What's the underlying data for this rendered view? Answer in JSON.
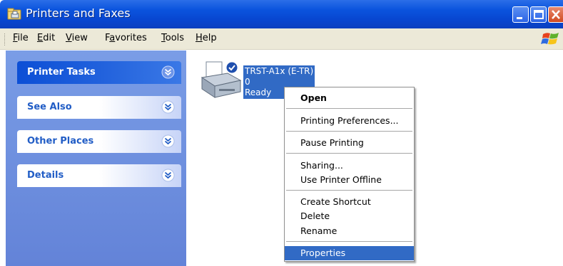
{
  "window": {
    "title": "Printers and Faxes",
    "icon": "printers-folder-icon"
  },
  "menubar": {
    "items": [
      {
        "label": "File",
        "accesskey": "F"
      },
      {
        "label": "Edit",
        "accesskey": "E"
      },
      {
        "label": "View",
        "accesskey": "V"
      },
      {
        "label": "Favorites",
        "accesskey": "a"
      },
      {
        "label": "Tools",
        "accesskey": "T"
      },
      {
        "label": "Help",
        "accesskey": "H"
      }
    ]
  },
  "taskpane": {
    "panels": [
      {
        "label": "Printer Tasks",
        "active": true
      },
      {
        "label": "See Also",
        "active": false
      },
      {
        "label": "Other Places",
        "active": false
      },
      {
        "label": "Details",
        "active": false
      }
    ]
  },
  "printer": {
    "name": "TRST-A1x (E-TR)",
    "documents": "0",
    "status": "Ready",
    "is_default": true
  },
  "context_menu": {
    "items": [
      {
        "label": "Open",
        "bold": true,
        "highlighted": false
      },
      {
        "label": "Printing Preferences...",
        "bold": false,
        "highlighted": false
      },
      {
        "label": "Pause Printing",
        "bold": false,
        "highlighted": false
      },
      {
        "label": "Sharing...",
        "bold": false,
        "highlighted": false
      },
      {
        "label": "Use Printer Offline",
        "bold": false,
        "highlighted": false
      },
      {
        "label": "Create Shortcut",
        "bold": false,
        "highlighted": false
      },
      {
        "label": "Delete",
        "bold": false,
        "highlighted": false
      },
      {
        "label": "Rename",
        "bold": false,
        "highlighted": false
      },
      {
        "label": "Properties",
        "bold": false,
        "highlighted": true
      }
    ]
  },
  "colors": {
    "titlebar": "#0a53dd",
    "selection": "#316ac5",
    "taskpane": "#6e90e0",
    "panel_text": "#215dc6"
  }
}
